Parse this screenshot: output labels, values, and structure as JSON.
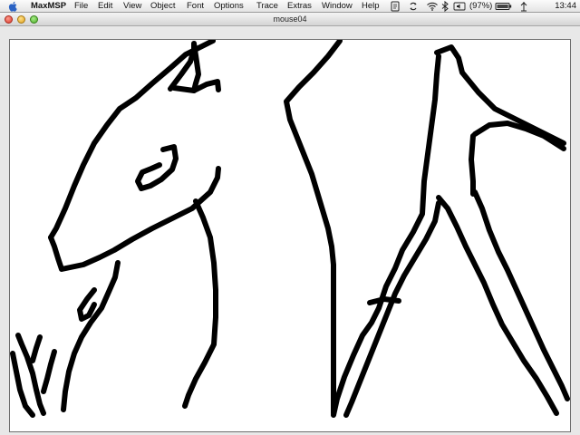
{
  "menubar": {
    "app_name": "MaxMSP",
    "items": [
      {
        "id": "file",
        "label": "File"
      },
      {
        "id": "edit",
        "label": "Edit"
      },
      {
        "id": "view",
        "label": "View"
      },
      {
        "id": "object",
        "label": "Object"
      },
      {
        "id": "font",
        "label": "Font"
      },
      {
        "id": "options",
        "label": "Options"
      },
      {
        "id": "trace",
        "label": "Trace"
      },
      {
        "id": "extras",
        "label": "Extras"
      },
      {
        "id": "window",
        "label": "Window"
      },
      {
        "id": "help",
        "label": "Help"
      }
    ],
    "status": {
      "battery_text": "(97%)",
      "clock": "13:44",
      "icons": [
        "script-menu-icon",
        "sync-icon",
        "bluetooth-icon",
        "wifi-icon",
        "volume-icon",
        "battery-icon"
      ]
    }
  },
  "window": {
    "title": "mouse04",
    "canvas": {
      "background": "#ffffff",
      "stroke_color": "#000000",
      "content": "freehand black line drawing"
    }
  },
  "colors": {
    "menubar_bg": "#eeeeee",
    "titlebar_bg": "#dedede",
    "close": "#e0443a",
    "minimize": "#e8aa28",
    "zoom": "#5cb833"
  }
}
